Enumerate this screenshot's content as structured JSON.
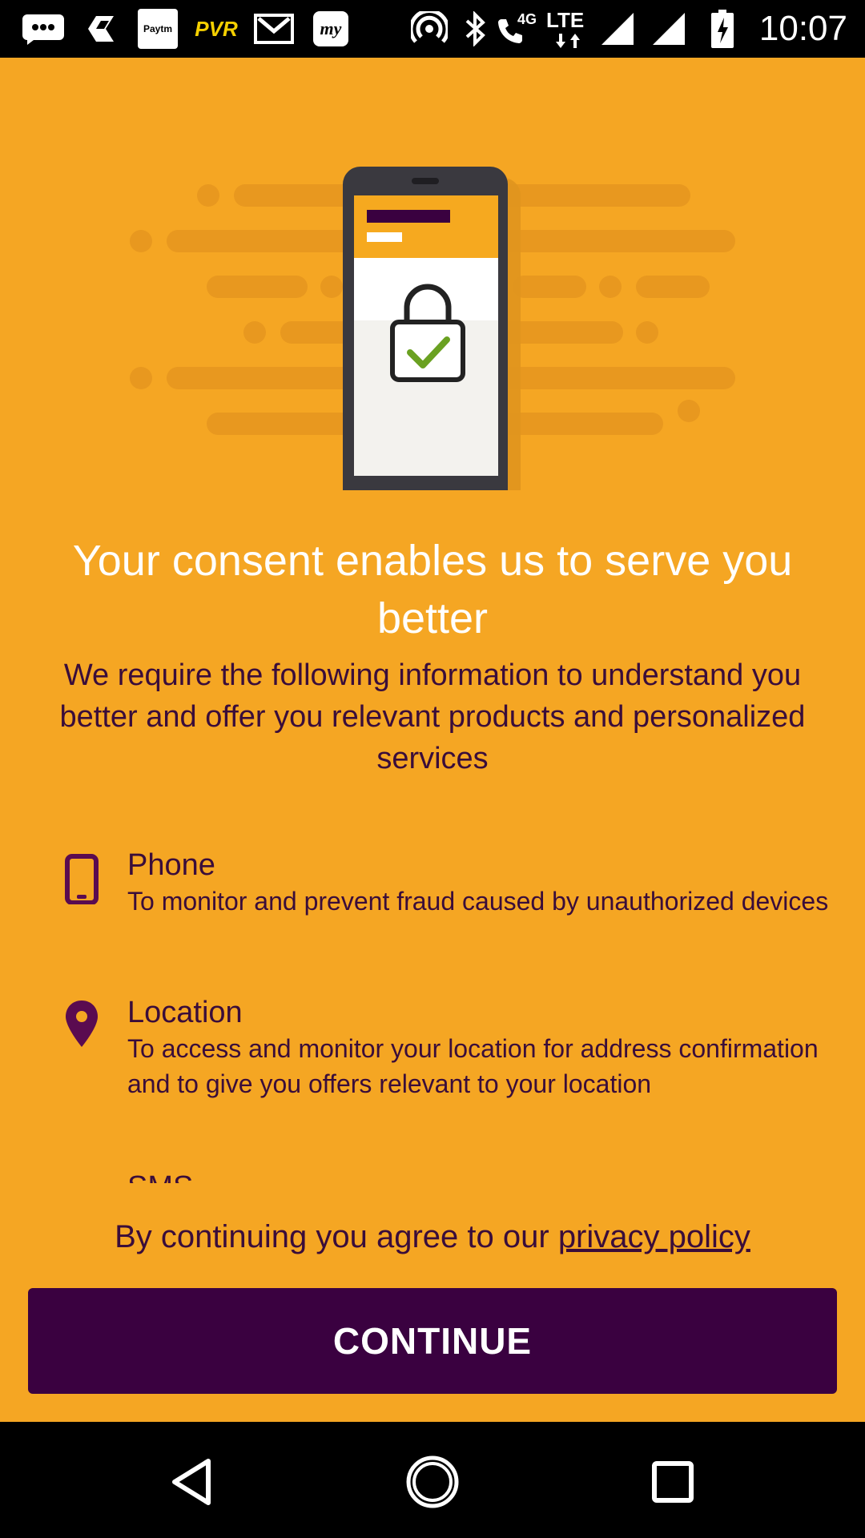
{
  "status_bar": {
    "time": "10:07",
    "network_label": "4G",
    "lte_label": "LTE",
    "notification_icons": [
      "messages-icon",
      "app-icon",
      "paytm-icon",
      "pvr-icon",
      "gmail-icon",
      "my-app-icon"
    ],
    "paytm_label": "Paytm",
    "pvr_label": "PVR",
    "my_label": "my"
  },
  "consent": {
    "title": "Your consent enables us to serve you better",
    "subtitle": "We require the following information to understand you better and offer you relevant products and personalized services",
    "permissions": [
      {
        "icon": "phone-icon",
        "title": "Phone",
        "description": "To monitor and prevent fraud caused by unauthorized devices"
      },
      {
        "icon": "location-pin-icon",
        "title": "Location",
        "description": "To access and monitor your location for address confirmation and to give you offers relevant to your location"
      },
      {
        "icon": "sms-icon",
        "title": "SMS",
        "description": ""
      }
    ],
    "agree_prefix": "By continuing you agree to our ",
    "privacy_link": "privacy policy",
    "continue_label": "CONTINUE"
  },
  "colors": {
    "background": "#F5A623",
    "accent_dark": "#3A0140",
    "text_dark": "#3A0D3A",
    "check_green": "#6AA121"
  },
  "nav_bar": {
    "back": "back-icon",
    "home": "home-icon",
    "recents": "recents-icon"
  }
}
